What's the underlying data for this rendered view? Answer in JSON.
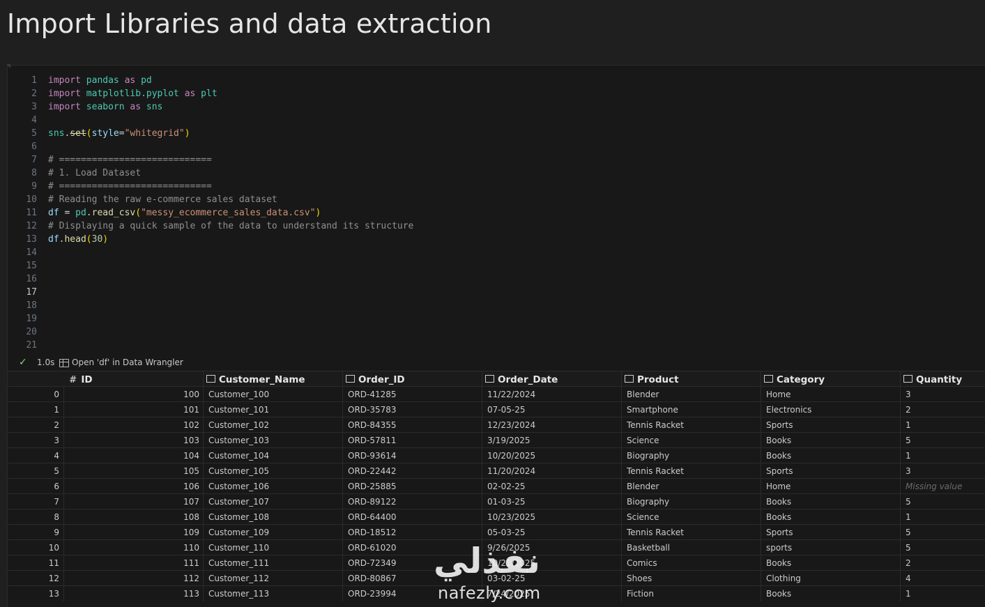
{
  "page": {
    "heading": "Import Libraries and data extraction"
  },
  "code": {
    "active_line": 17,
    "line_numbers": [
      "1",
      "2",
      "3",
      "4",
      "5",
      "6",
      "7",
      "8",
      "9",
      "10",
      "11",
      "12",
      "13",
      "14",
      "15",
      "16",
      "17",
      "18",
      "19",
      "20",
      "21"
    ]
  },
  "status": {
    "time": "1.0s",
    "wrangler_link": "Open 'df' in Data Wrangler"
  },
  "table": {
    "columns": [
      {
        "label": "ID",
        "type_icon": "hash-icon"
      },
      {
        "label": "Customer_Name",
        "type_icon": "text-type-icon"
      },
      {
        "label": "Order_ID",
        "type_icon": "text-type-icon"
      },
      {
        "label": "Order_Date",
        "type_icon": "text-type-icon"
      },
      {
        "label": "Product",
        "type_icon": "text-type-icon"
      },
      {
        "label": "Category",
        "type_icon": "text-type-icon"
      },
      {
        "label": "Quantity",
        "type_icon": "text-type-icon"
      }
    ],
    "index_symbol": "#",
    "rows": [
      {
        "idx": "0",
        "id": "100",
        "customer": "Customer_100",
        "order": "ORD-41285",
        "date": "11/22/2024",
        "product": "Blender",
        "category": "Home",
        "qty": "3"
      },
      {
        "idx": "1",
        "id": "101",
        "customer": "Customer_101",
        "order": "ORD-35783",
        "date": "07-05-25",
        "product": "Smartphone",
        "category": "Electronics",
        "qty": "2"
      },
      {
        "idx": "2",
        "id": "102",
        "customer": "Customer_102",
        "order": "ORD-84355",
        "date": "12/23/2024",
        "product": "Tennis Racket",
        "category": "Sports",
        "qty": "1"
      },
      {
        "idx": "3",
        "id": "103",
        "customer": "Customer_103",
        "order": "ORD-57811",
        "date": "3/19/2025",
        "product": "Science",
        "category": "Books",
        "qty": "5"
      },
      {
        "idx": "4",
        "id": "104",
        "customer": "Customer_104",
        "order": "ORD-93614",
        "date": "10/20/2025",
        "product": "Biography",
        "category": "Books",
        "qty": "1"
      },
      {
        "idx": "5",
        "id": "105",
        "customer": "Customer_105",
        "order": "ORD-22442",
        "date": "11/20/2024",
        "product": "Tennis Racket",
        "category": "Sports",
        "qty": "3"
      },
      {
        "idx": "6",
        "id": "106",
        "customer": "Customer_106",
        "order": "ORD-25885",
        "date": "02-02-25",
        "product": "Blender",
        "category": "Home",
        "qty": "Missing value"
      },
      {
        "idx": "7",
        "id": "107",
        "customer": "Customer_107",
        "order": "ORD-89122",
        "date": "01-03-25",
        "product": "Biography",
        "category": "Books",
        "qty": "5"
      },
      {
        "idx": "8",
        "id": "108",
        "customer": "Customer_108",
        "order": "ORD-64400",
        "date": "10/23/2025",
        "product": "Science",
        "category": "Books",
        "qty": "1"
      },
      {
        "idx": "9",
        "id": "109",
        "customer": "Customer_109",
        "order": "ORD-18512",
        "date": "05-03-25",
        "product": "Tennis Racket",
        "category": "Sports",
        "qty": "5"
      },
      {
        "idx": "10",
        "id": "110",
        "customer": "Customer_110",
        "order": "ORD-61020",
        "date": "9/26/2025",
        "product": "Basketball",
        "category": "sports",
        "qty": "5"
      },
      {
        "idx": "11",
        "id": "111",
        "customer": "Customer_111",
        "order": "ORD-72349",
        "date": "10/21/2025",
        "product": "Comics",
        "category": "Books",
        "qty": "2"
      },
      {
        "idx": "12",
        "id": "112",
        "customer": "Customer_112",
        "order": "ORD-80867",
        "date": "03-02-25",
        "product": "Shoes",
        "category": "Clothing",
        "qty": "4"
      },
      {
        "idx": "13",
        "id": "113",
        "customer": "Customer_113",
        "order": "ORD-23994",
        "date": "7/24/2025",
        "product": "Fiction",
        "category": "Books",
        "qty": "1"
      }
    ]
  },
  "watermark": {
    "arabic": "نفذلي",
    "latin": "nafezly.com"
  }
}
